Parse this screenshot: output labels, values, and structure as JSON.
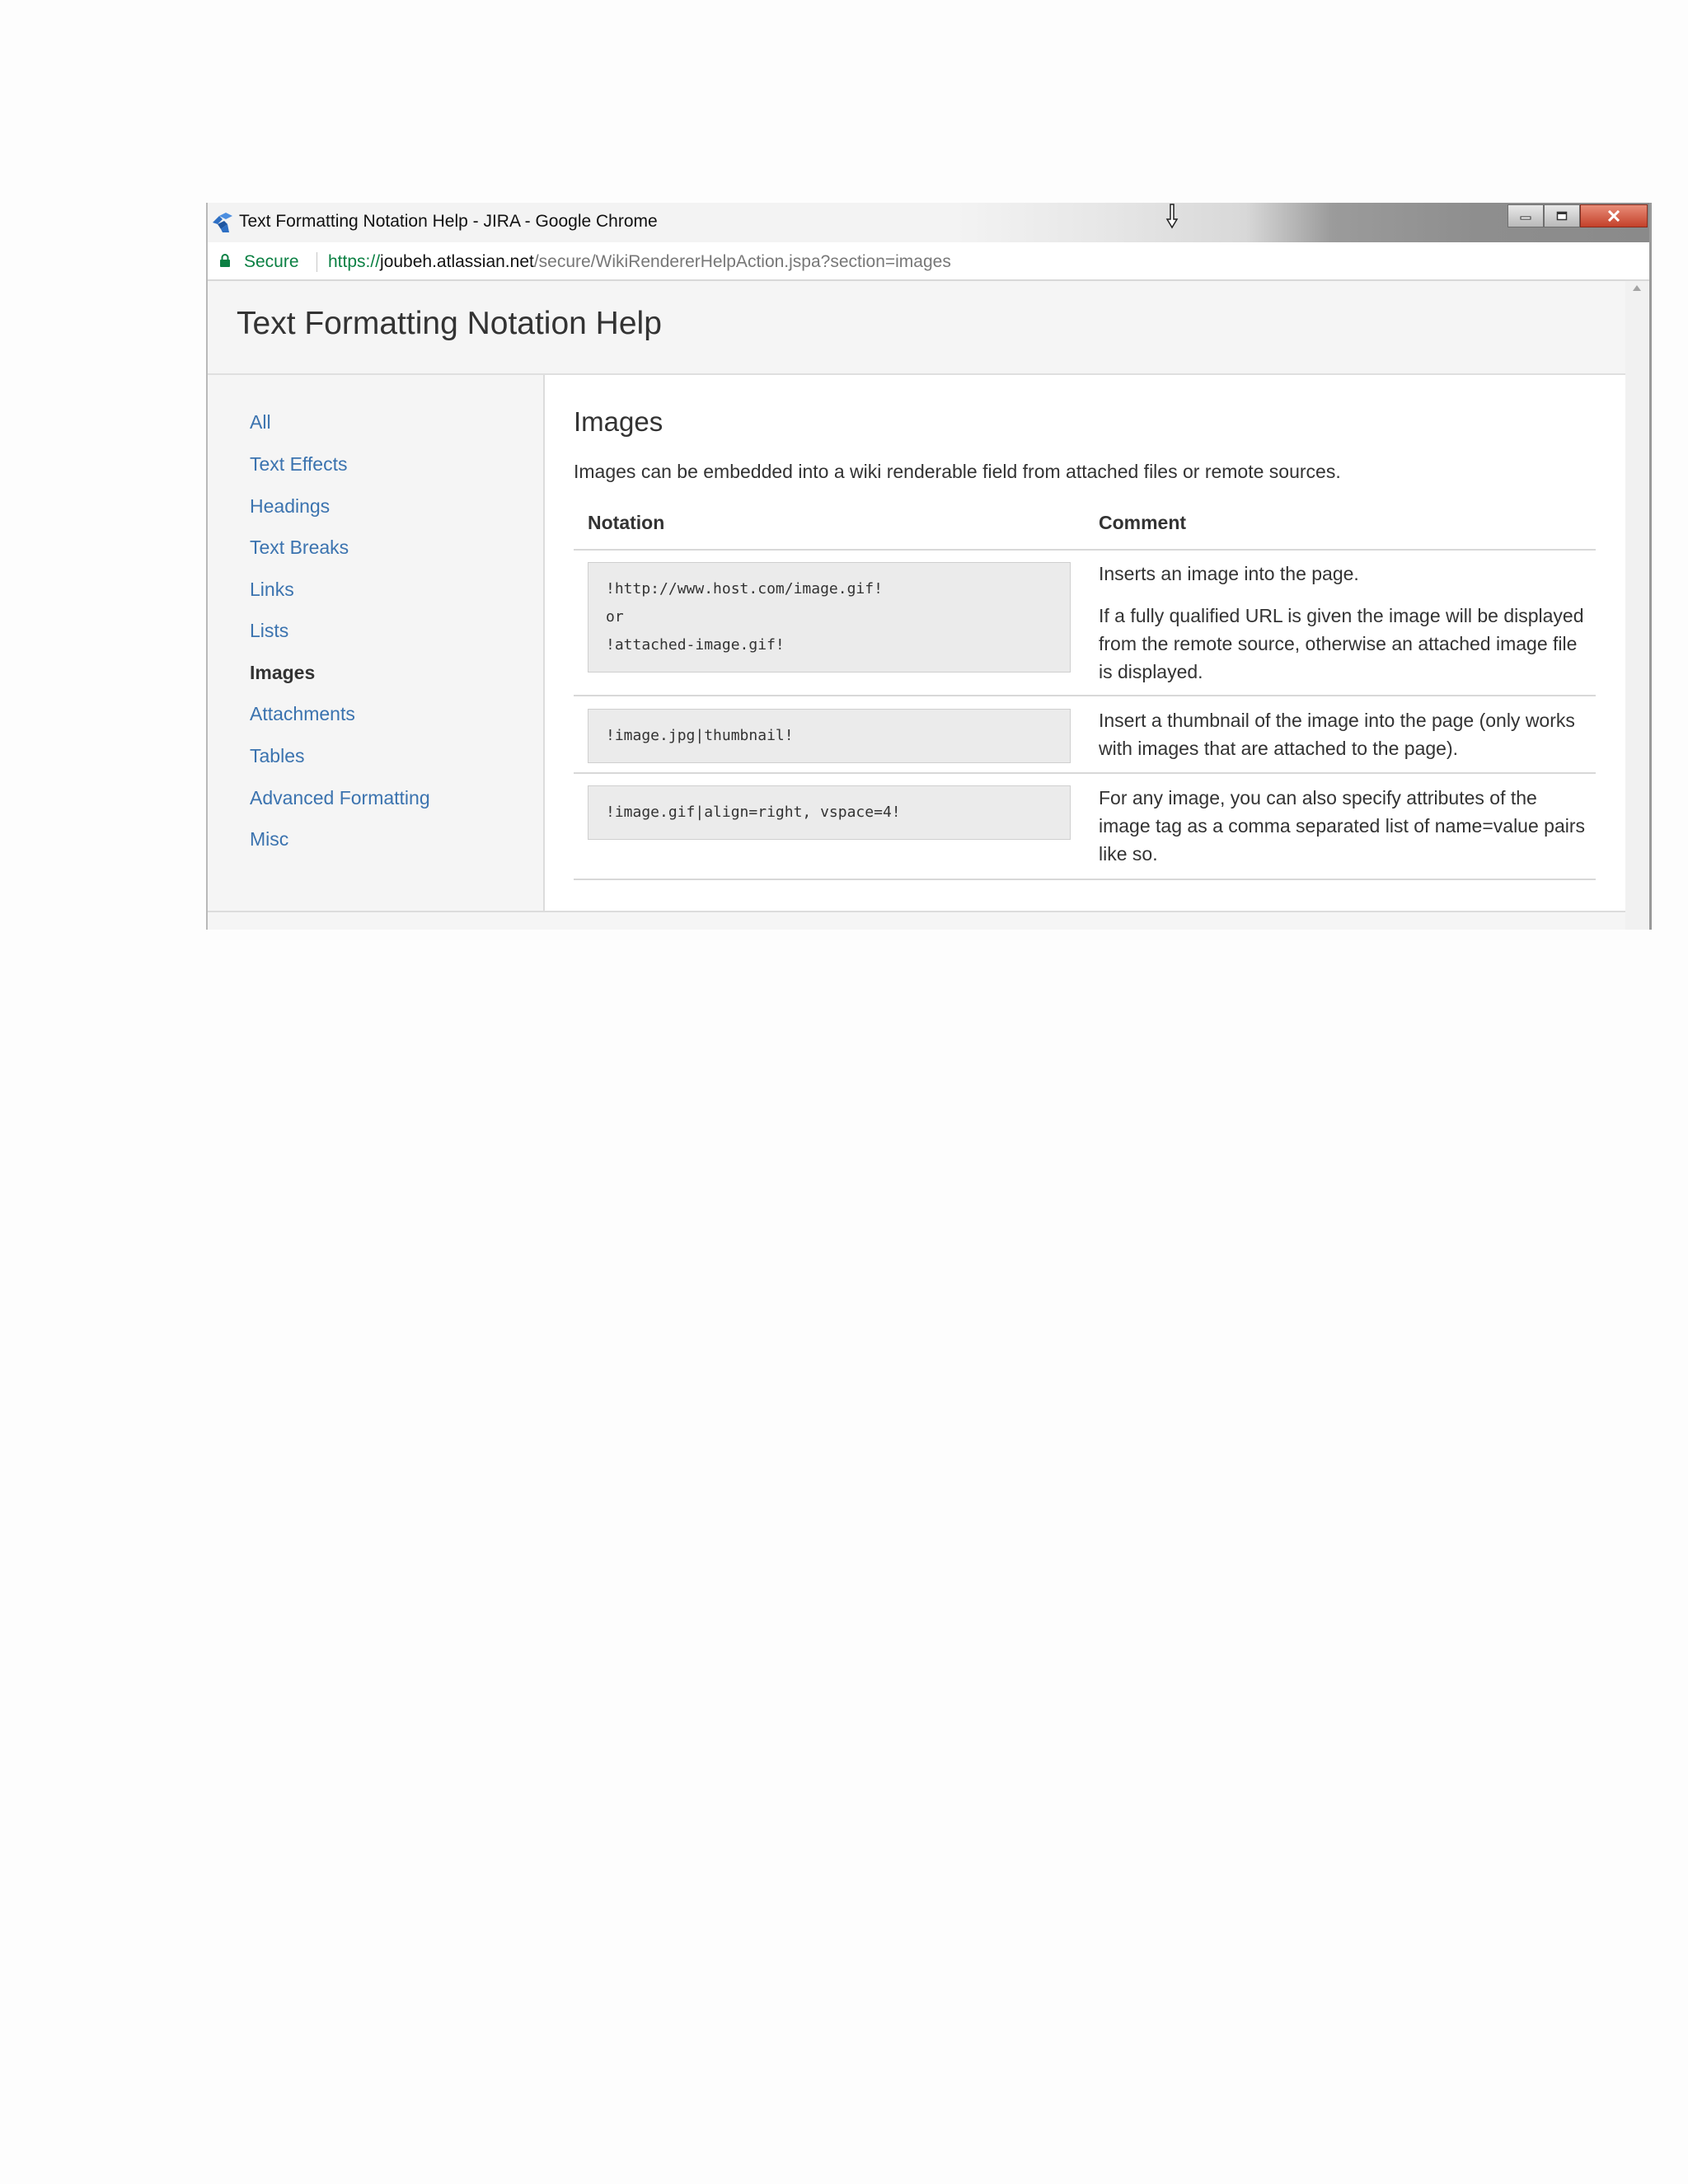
{
  "window": {
    "title": "Text Formatting Notation Help - JIRA - Google Chrome",
    "controls": {
      "minimize_icon": "minimize-icon",
      "maximize_icon": "maximize-icon",
      "close_icon": "close-icon"
    }
  },
  "address_bar": {
    "secure_label": "Secure",
    "url_scheme": "https://",
    "url_host": "joubeh.atlassian.net",
    "url_path": "/secure/WikiRendererHelpAction.jspa?section=images"
  },
  "page": {
    "title": "Text Formatting Notation Help"
  },
  "sidebar": {
    "items": [
      {
        "label": "All",
        "active": false
      },
      {
        "label": "Text Effects",
        "active": false
      },
      {
        "label": "Headings",
        "active": false
      },
      {
        "label": "Text Breaks",
        "active": false
      },
      {
        "label": "Links",
        "active": false
      },
      {
        "label": "Lists",
        "active": false
      },
      {
        "label": "Images",
        "active": true
      },
      {
        "label": "Attachments",
        "active": false
      },
      {
        "label": "Tables",
        "active": false
      },
      {
        "label": "Advanced Formatting",
        "active": false
      },
      {
        "label": "Misc",
        "active": false
      }
    ]
  },
  "section": {
    "title": "Images",
    "description": "Images can be embedded into a wiki renderable field from attached files or remote sources.",
    "table": {
      "headers": {
        "notation": "Notation",
        "comment": "Comment"
      },
      "rows": [
        {
          "notation": [
            "!http://www.host.com/image.gif!",
            "or",
            "!attached-image.gif!"
          ],
          "comment": [
            "Inserts an image into the page.",
            "If a fully qualified URL is given the image will be displayed from the remote source, otherwise an attached image file is displayed."
          ]
        },
        {
          "notation": [
            "!image.jpg|thumbnail!"
          ],
          "comment": [
            "Insert a thumbnail of the image into the page (only works with images that are attached to the page)."
          ]
        },
        {
          "notation": [
            "!image.gif|align=right, vspace=4!"
          ],
          "comment": [
            "For any image, you can also specify attributes of the image tag as a comma separated list of name=value pairs like so."
          ]
        }
      ]
    }
  },
  "colors": {
    "link": "#3b73af",
    "secure_green": "#0b8043",
    "text": "#333333",
    "code_background": "#ebebeb",
    "close_button": "#c4412a"
  }
}
